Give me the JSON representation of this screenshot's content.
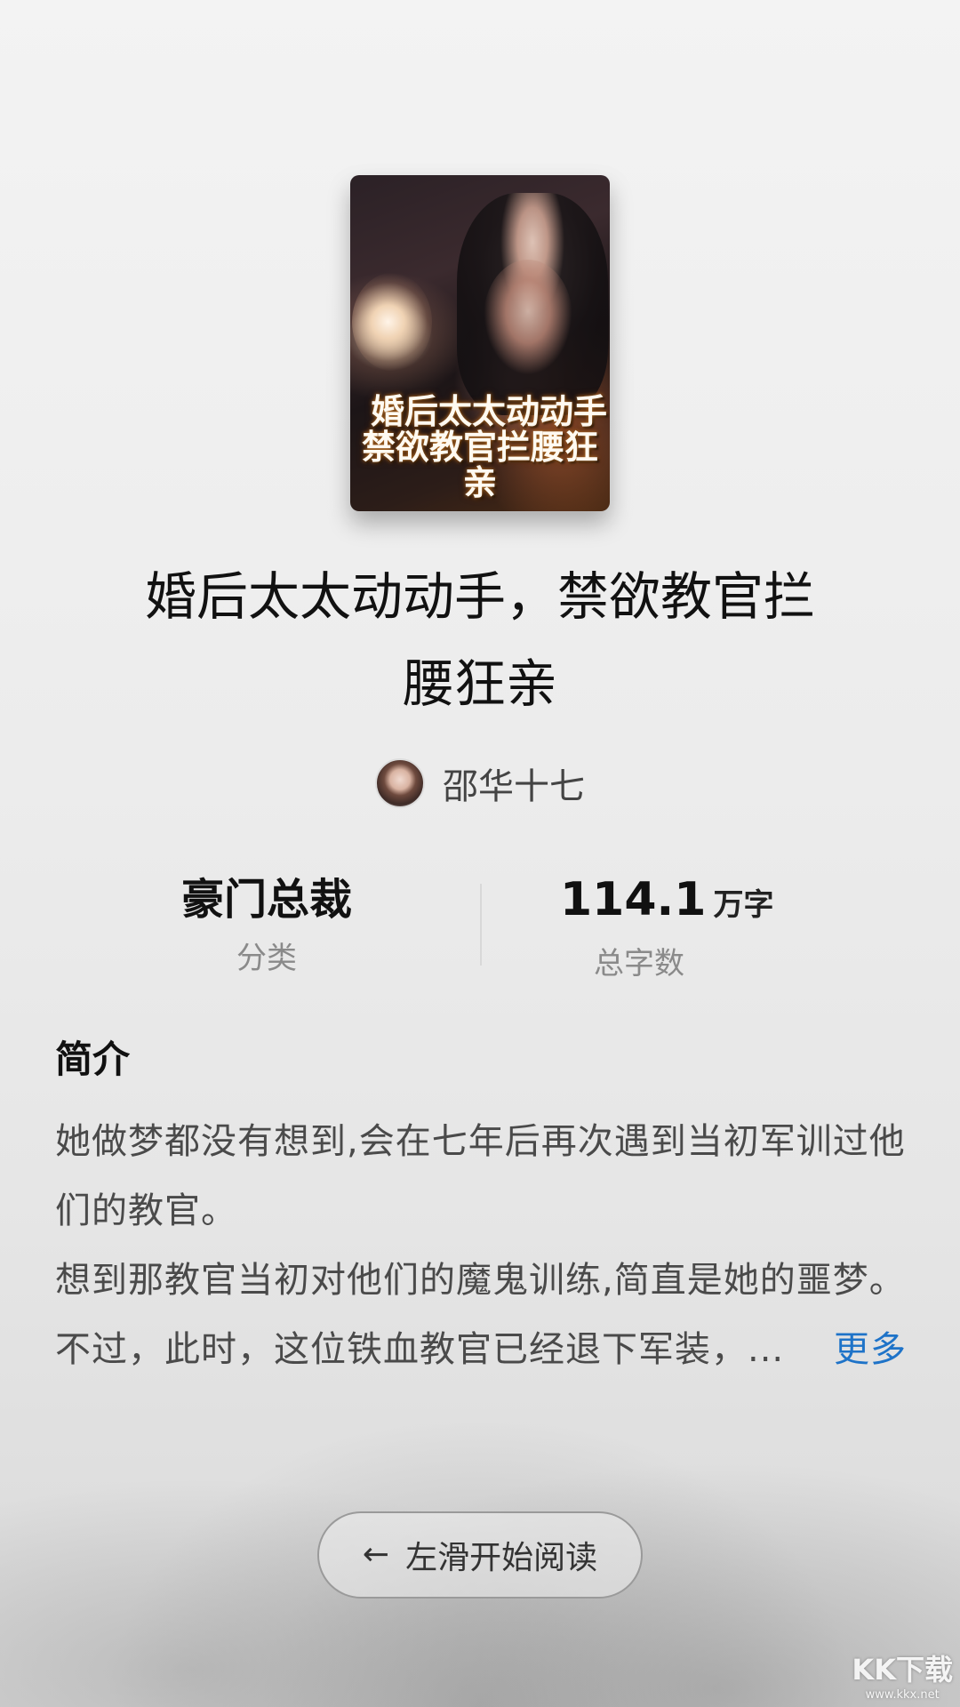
{
  "book": {
    "cover_title_line1": "婚后太太动动手",
    "cover_title_line2": "禁欲教官拦腰狂亲",
    "title_line1": "婚后太太动动手，禁欲教官拦",
    "title_line2": "腰狂亲",
    "author": "邵华十七"
  },
  "stats": {
    "category_value": "豪门总裁",
    "category_label": "分类",
    "word_count_value": "114.1",
    "word_count_unit": "万字",
    "word_count_label": "总字数"
  },
  "intro": {
    "heading": "简介",
    "paragraph1": "她做梦都没有想到,会在七年后再次遇到当初军训过他们的教官。",
    "paragraph2": "想到那教官当初对他们的魔鬼训练,简直是她的噩梦。",
    "paragraph3": "不过，此时，这位铁血教官已经退下军装，...",
    "more_label": "更多"
  },
  "actions": {
    "start_reading_label": "左滑开始阅读",
    "arrow_icon": "←"
  },
  "watermark": {
    "main": "KK下载",
    "sub": "www.kkx.net"
  }
}
